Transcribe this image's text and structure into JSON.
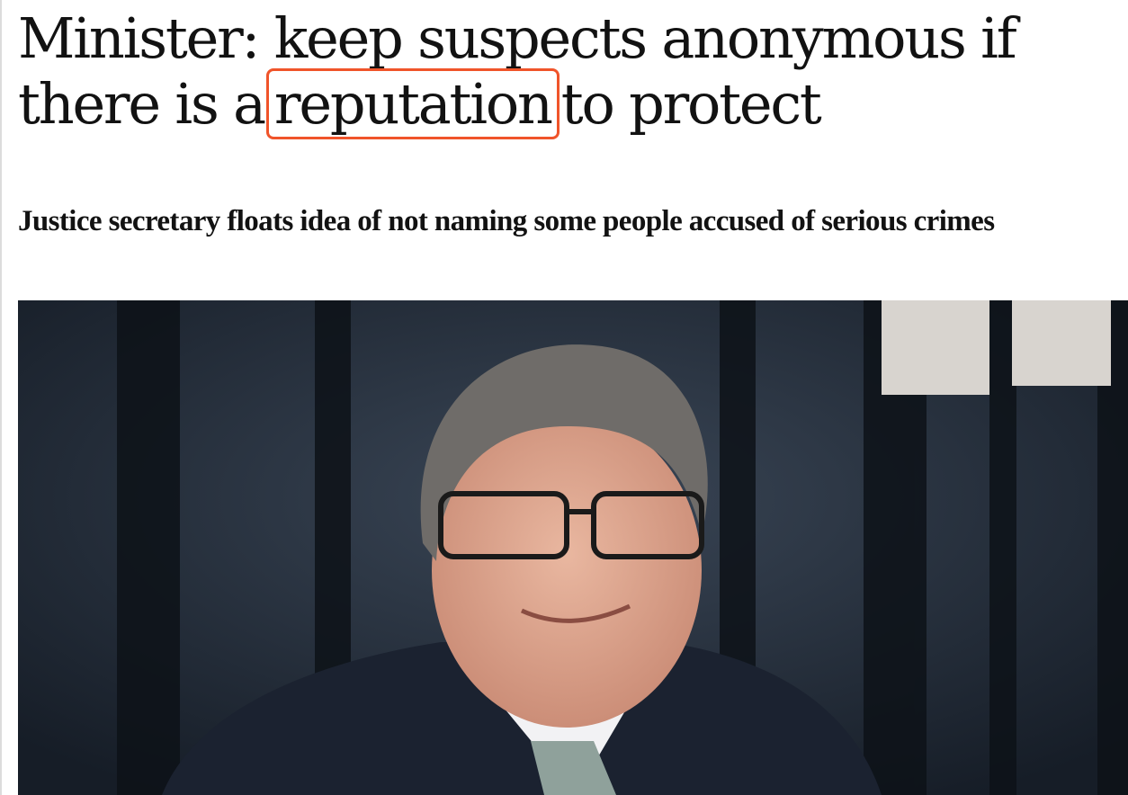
{
  "article": {
    "headline_part1": "Minister: keep suspects anonymous if there is a",
    "headline_highlight": "reputation",
    "headline_part2": "to protect",
    "standfirst": "Justice secretary floats idea of not naming some people accused of serious crimes",
    "highlight_color": "#f0542a"
  }
}
